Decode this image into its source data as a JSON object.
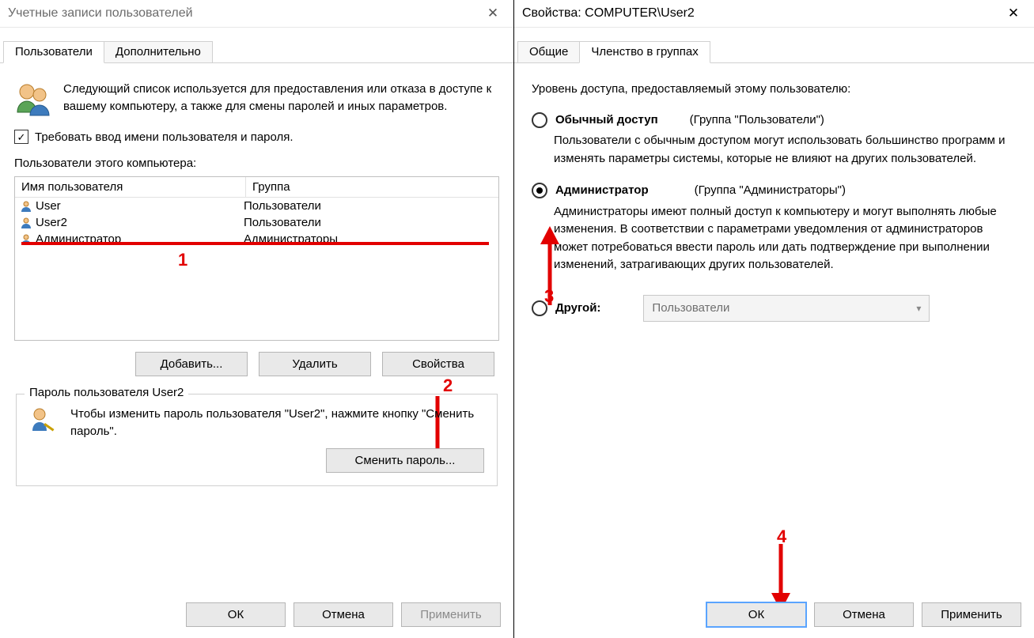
{
  "left": {
    "title": "Учетные записи пользователей",
    "tabs": {
      "t1": "Пользователи",
      "t2": "Дополнительно"
    },
    "intro": "Следующий список используется для предоставления или отказа в доступе к вашему компьютеру, а также для смены паролей и иных параметров.",
    "require_login": "Требовать ввод имени пользователя и пароля.",
    "list_label": "Пользователи этого компьютера:",
    "cols": {
      "user": "Имя пользователя",
      "group": "Группа"
    },
    "rows": [
      {
        "name": "User",
        "group": "Пользователи"
      },
      {
        "name": "User2",
        "group": "Пользователи"
      },
      {
        "name": "Администратор",
        "group": "Администраторы"
      }
    ],
    "buttons": {
      "add": "Добавить...",
      "del": "Удалить",
      "prop": "Свойства"
    },
    "groupbox": {
      "legend": "Пароль пользователя User2",
      "text": "Чтобы изменить пароль пользователя \"User2\", нажмите кнопку \"Сменить пароль\".",
      "btn": "Сменить пароль..."
    },
    "bottom": {
      "ok": "ОК",
      "cancel": "Отмена",
      "apply": "Применить"
    },
    "anno1": "1",
    "anno2": "2"
  },
  "right": {
    "title": "Свойства: COMPUTER\\User2",
    "tabs": {
      "t1": "Общие",
      "t2": "Членство в группах"
    },
    "intro": "Уровень доступа, предоставляемый этому пользователю:",
    "opt1": {
      "label": "Обычный доступ",
      "group": "(Группа \"Пользователи\")",
      "desc": "Пользователи с обычным доступом могут использовать большинство программ и изменять параметры системы, которые не влияют на других пользователей."
    },
    "opt2": {
      "label": "Администратор",
      "group": "(Группа \"Администраторы\")",
      "desc": "Администраторы имеют полный доступ к компьютеру и могут выполнять любые изменения. В соответствии с параметрами уведомления от администраторов может потребоваться ввести пароль или дать подтверждение при выполнении изменений, затрагивающих других пользователей."
    },
    "opt3": {
      "label": "Другой:",
      "combo": "Пользователи"
    },
    "bottom": {
      "ok": "ОК",
      "cancel": "Отмена",
      "apply": "Применить"
    },
    "anno3": "3",
    "anno4": "4"
  }
}
